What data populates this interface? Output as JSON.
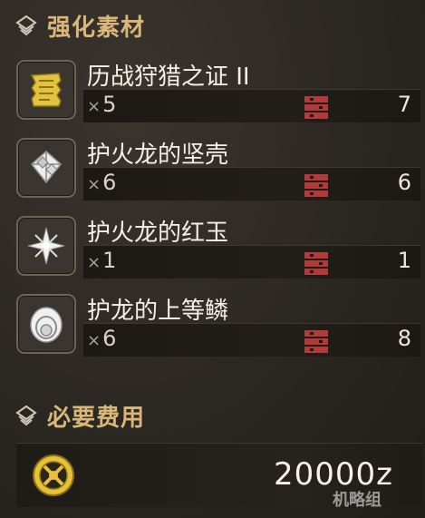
{
  "upgrade_header": {
    "title": "强化素材",
    "icon": "layers-icon"
  },
  "materials": [
    {
      "name": "历战狩猎之证 II",
      "req_prefix": "×",
      "required": "5",
      "owned": "7",
      "icon": "scroll-icon",
      "icon_color": "#e2c23f"
    },
    {
      "name": "护火龙的坚壳",
      "req_prefix": "×",
      "required": "6",
      "owned": "6",
      "icon": "shell-plates-icon",
      "icon_color": "#e8e8e8"
    },
    {
      "name": "护火龙的红玉",
      "req_prefix": "×",
      "required": "1",
      "owned": "1",
      "icon": "gem-star-icon",
      "icon_color": "#f0f0f0"
    },
    {
      "name": "护龙的上等鳞",
      "req_prefix": "×",
      "required": "6",
      "owned": "8",
      "icon": "scale-icon",
      "icon_color": "#f0f0f0"
    }
  ],
  "box_icon": {
    "name": "item-box-icon",
    "color": "#b23a3a"
  },
  "cost_header": {
    "title": "必要费用",
    "icon": "layers-icon"
  },
  "cost": {
    "value": "20000z",
    "icon": "coin-icon",
    "icon_color": "#e6c23a"
  },
  "watermark": "机略组"
}
